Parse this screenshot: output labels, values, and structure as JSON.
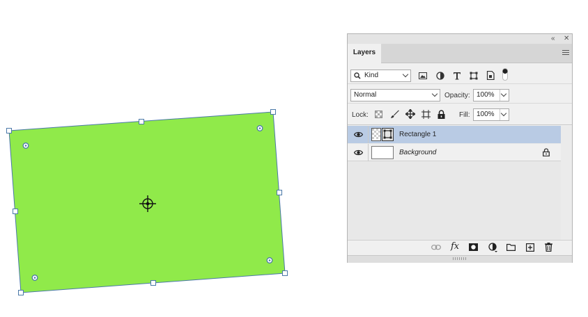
{
  "panel": {
    "collapse_icon": "double-chevron-left-icon",
    "close_icon": "close-icon",
    "tab_label": "Layers",
    "menu_icon": "panel-menu-icon"
  },
  "filter": {
    "kind_label": "Kind",
    "filter_icons": [
      "image-filter-icon",
      "adjustment-filter-icon",
      "type-filter-icon",
      "shape-filter-icon",
      "smart-object-filter-icon",
      "filter-toggle-icon"
    ]
  },
  "blend": {
    "mode": "Normal",
    "opacity_label": "Opacity:",
    "opacity_value": "100%"
  },
  "lock": {
    "label": "Lock:",
    "fill_label": "Fill:",
    "fill_value": "100%"
  },
  "layers": [
    {
      "name": "Rectangle 1",
      "selected": true,
      "locked": false
    },
    {
      "name": "Background",
      "selected": false,
      "locked": true
    }
  ],
  "bottom_icons": [
    "link-layers-icon",
    "fx-icon",
    "add-mask-icon",
    "adjustment-layer-icon",
    "new-group-icon",
    "new-layer-icon",
    "delete-layer-icon"
  ],
  "bottom_fx": "fx",
  "shape": {
    "fill_color": "#90ea4a",
    "stroke_color": "#4a78a8"
  },
  "colors": {
    "selection": "#b9cbe4",
    "panel_bg": "#f0f0f0"
  }
}
